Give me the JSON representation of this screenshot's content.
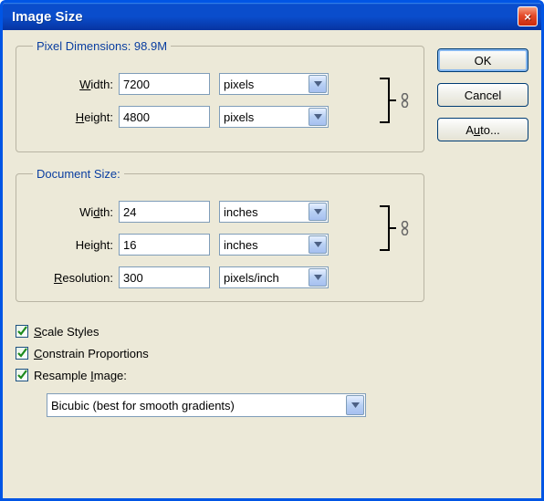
{
  "window": {
    "title": "Image Size",
    "close_glyph": "×"
  },
  "buttons": {
    "ok": "OK",
    "cancel": "Cancel",
    "auto_pre": "A",
    "auto_ul": "u",
    "auto_post": "to..."
  },
  "pixel_dimensions": {
    "legend": "Pixel Dimensions:  98.9M",
    "width_label_ul": "W",
    "width_label_post": "idth:",
    "width_value": "7200",
    "width_unit": "pixels",
    "height_label_ul": "H",
    "height_label_post": "eight:",
    "height_value": "4800",
    "height_unit": "pixels"
  },
  "document_size": {
    "legend": "Document Size:",
    "width_label_pre": "Wi",
    "width_label_ul": "d",
    "width_label_post": "th:",
    "width_value": "24",
    "width_unit": "inches",
    "height_label_pre": "Hei",
    "height_label_ul": "g",
    "height_label_post": "ht:",
    "height_value": "16",
    "height_unit": "inches",
    "res_label_ul": "R",
    "res_label_post": "esolution:",
    "res_value": "300",
    "res_unit": "pixels/inch"
  },
  "checks": {
    "scale_pre": "",
    "scale_ul": "S",
    "scale_post": "cale Styles",
    "constrain_ul": "C",
    "constrain_post": "onstrain Proportions",
    "resample_pre": "Resample ",
    "resample_ul": "I",
    "resample_post": "mage:",
    "method": "Bicubic (best for smooth gradients)"
  }
}
